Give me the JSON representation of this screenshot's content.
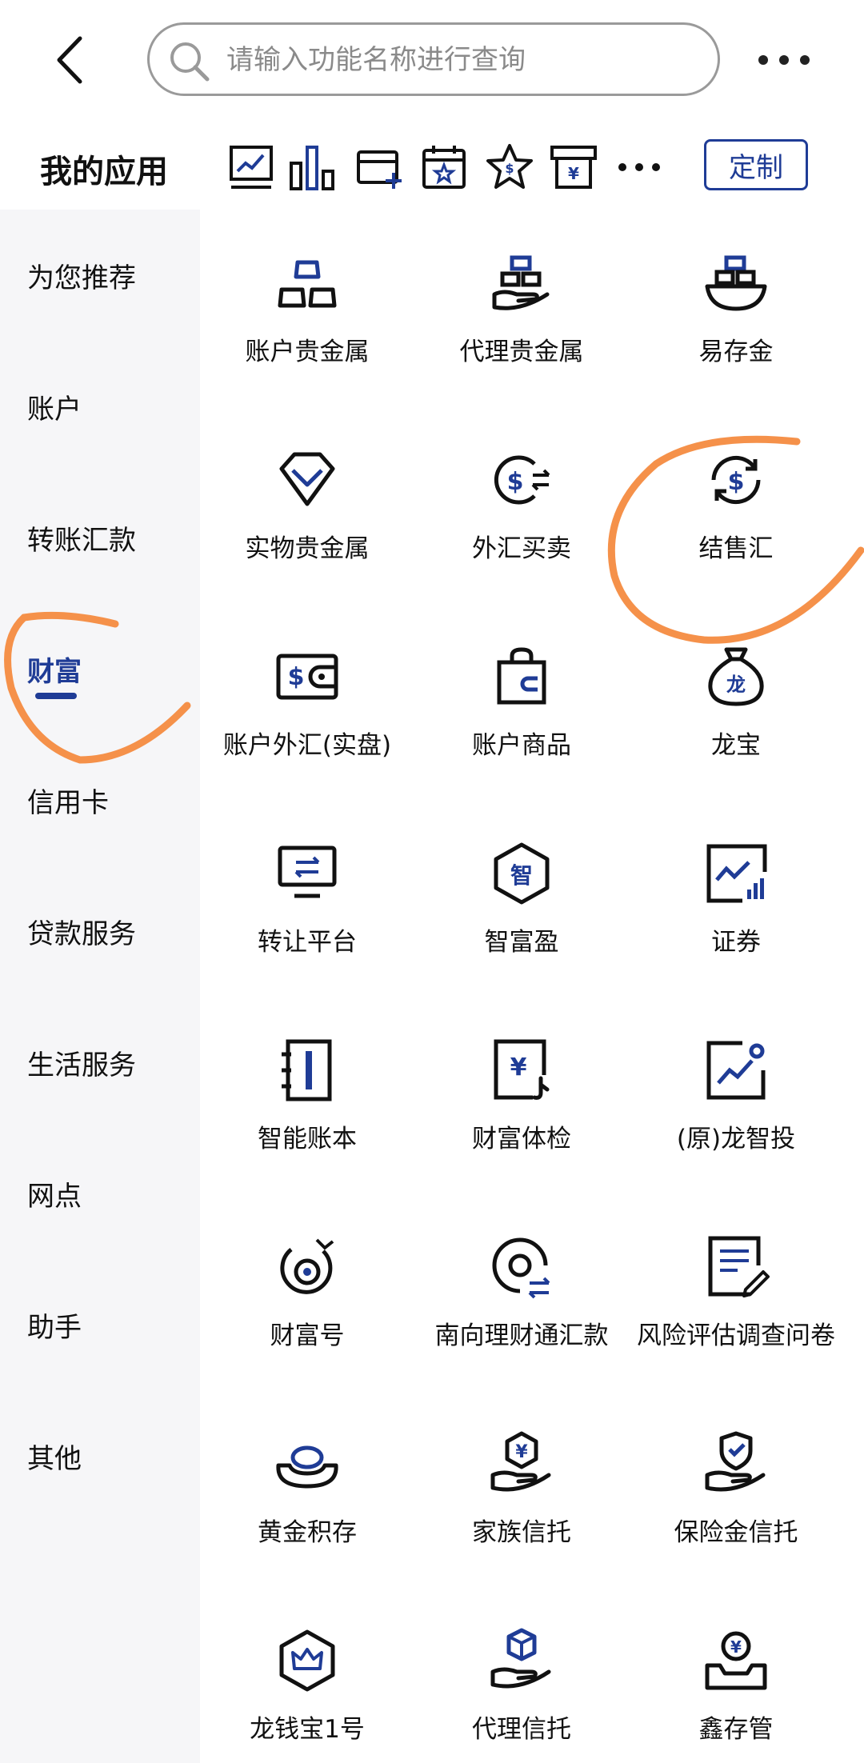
{
  "search": {
    "placeholder": "请输入功能名称进行查询",
    "value": ""
  },
  "myapps": {
    "title": "我的应用",
    "customize_label": "定制"
  },
  "sidebar": {
    "items": [
      {
        "label": "为您推荐"
      },
      {
        "label": "账户"
      },
      {
        "label": "转账汇款"
      },
      {
        "label": "财富",
        "active": true
      },
      {
        "label": "信用卡"
      },
      {
        "label": "贷款服务"
      },
      {
        "label": "生活服务"
      },
      {
        "label": "网点"
      },
      {
        "label": "助手"
      },
      {
        "label": "其他"
      }
    ]
  },
  "grid": {
    "items": [
      {
        "label": "账户贵金属",
        "icon": "gold-bars-icon"
      },
      {
        "label": "代理贵金属",
        "icon": "gold-hand-icon"
      },
      {
        "label": "易存金",
        "icon": "gold-bowl-icon"
      },
      {
        "label": "实物贵金属",
        "icon": "diamond-icon"
      },
      {
        "label": "外汇买卖",
        "icon": "dollar-exchange-icon"
      },
      {
        "label": "结售汇",
        "icon": "dollar-cycle-icon"
      },
      {
        "label": "账户外汇(实盘)",
        "icon": "wallet-dollar-icon"
      },
      {
        "label": "账户商品",
        "icon": "shopping-bag-icon"
      },
      {
        "label": "龙宝",
        "icon": "money-bag-icon"
      },
      {
        "label": "转让平台",
        "icon": "monitor-transfer-icon"
      },
      {
        "label": "智富盈",
        "icon": "hexagon-zhi-icon"
      },
      {
        "label": "证券",
        "icon": "stock-chart-icon"
      },
      {
        "label": "智能账本",
        "icon": "ledger-book-icon"
      },
      {
        "label": "财富体检",
        "icon": "yuan-check-icon"
      },
      {
        "label": "(原)龙智投",
        "icon": "trend-up-icon"
      },
      {
        "label": "财富号",
        "icon": "target-icon"
      },
      {
        "label": "南向理财通汇款",
        "icon": "coin-transfer-icon"
      },
      {
        "label": "风险评估调查问卷",
        "icon": "survey-edit-icon"
      },
      {
        "label": "黄金积存",
        "icon": "gold-ingot-icon"
      },
      {
        "label": "家族信托",
        "icon": "hand-yuan-icon"
      },
      {
        "label": "保险金信托",
        "icon": "hand-shield-icon"
      },
      {
        "label": "龙钱宝1号",
        "icon": "hexagon-crown-icon"
      },
      {
        "label": "代理信托",
        "icon": "hand-cube-icon"
      },
      {
        "label": "鑫存管",
        "icon": "coin-box-icon"
      }
    ]
  },
  "colors": {
    "accent": "#1f3c96",
    "annotation": "#f5914a",
    "sidebar_bg": "#f6f6f8"
  }
}
